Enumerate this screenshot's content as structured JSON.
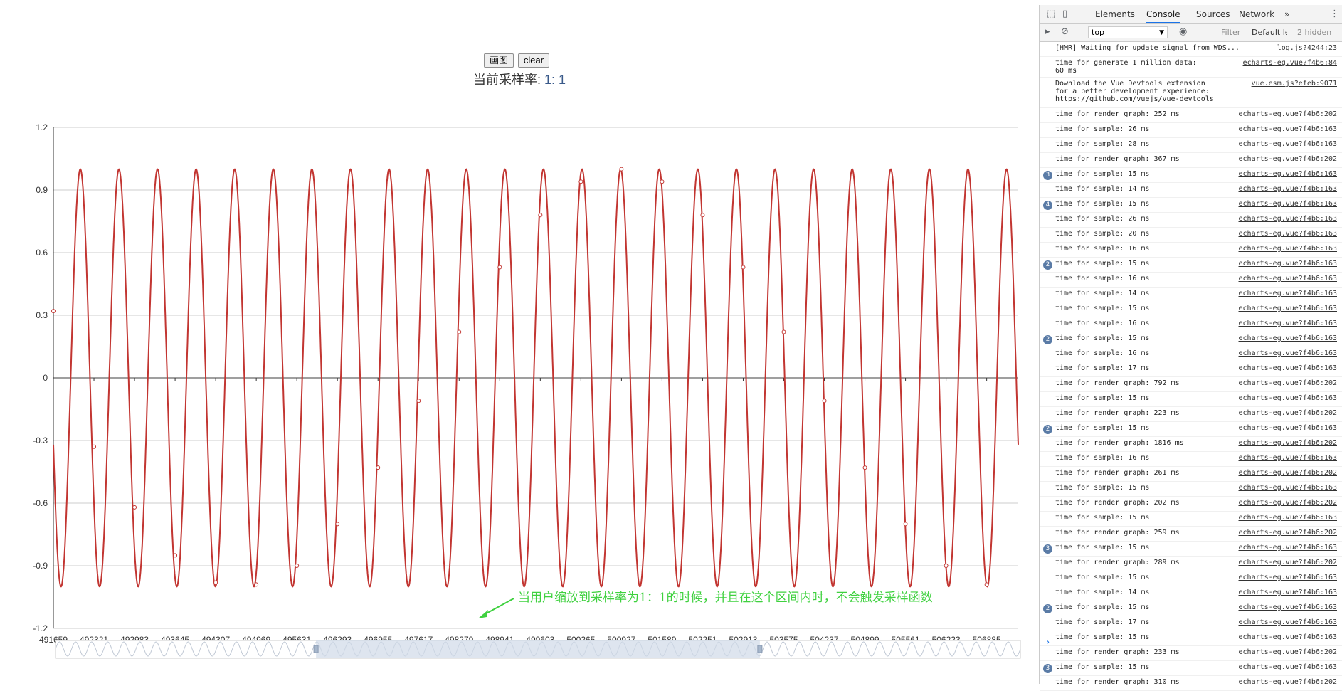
{
  "buttons": {
    "draw": "画图",
    "clear": "clear"
  },
  "rate": {
    "label": "当前采样率: ",
    "value": "1: 1"
  },
  "annotation": "当用户缩放到采样率为1：1的时候，并且在这个区间内时，不会触发采样函数",
  "colors": {
    "series": "#c23531",
    "annotation": "#3fd13f",
    "zoom_fill": "#d0dae8"
  },
  "chart_data": {
    "type": "line",
    "title": "",
    "xlabel": "",
    "ylabel": "",
    "ylim": [
      -1.2,
      1.2
    ],
    "yticks": [
      "1.2",
      "0.9",
      "0.6",
      "0.3",
      "0",
      "-0.3",
      "-0.6",
      "-0.9",
      "-1.2"
    ],
    "xlim": [
      491659,
      507400
    ],
    "xticks": [
      "491659",
      "492321",
      "492983",
      "493645",
      "494307",
      "494969",
      "495631",
      "496293",
      "496955",
      "497617",
      "498279",
      "498941",
      "499603",
      "500265",
      "500927",
      "501589",
      "502251",
      "502913",
      "503575",
      "504237",
      "504899",
      "505561",
      "506223",
      "506885"
    ],
    "grid": true,
    "series": [
      {
        "function": "sin",
        "amplitude": 1,
        "phase_at_start": 0.32,
        "cycles_in_view": 25,
        "values_at_ticks": [
          0.32,
          -0.33,
          -0.62,
          -0.85,
          -0.98,
          -0.99,
          -0.9,
          -0.7,
          -0.43,
          -0.11,
          0.22,
          0.53,
          0.78,
          0.94,
          1.0,
          0.94,
          0.78,
          0.53,
          0.22,
          -0.11,
          -0.43,
          -0.7,
          -0.9,
          -0.99
        ]
      }
    ],
    "datazoom": {
      "start_fraction": 0.27,
      "end_fraction": 0.73
    }
  },
  "devtools": {
    "tabs": [
      "Elements",
      "Console",
      "Sources",
      "Network",
      "»"
    ],
    "active_tab": "Console",
    "context": "top",
    "filter": "Filter",
    "levels": "Default levels",
    "hidden": "2 hidden",
    "messages": [
      {
        "text": "[HMR] Waiting for update signal from WDS...",
        "src": "log.js?4244:23",
        "count": ""
      },
      {
        "text": "time for generate 1 million data:\n60 ms",
        "src": "echarts-eg.vue?f4b6:84",
        "count": "",
        "tall": "2"
      },
      {
        "text": "Download the Vue Devtools extension\nfor a better development experience:\nhttps://github.com/vuejs/vue-devtools",
        "src": "vue.esm.js?efeb:9071",
        "count": "",
        "tall": "3"
      },
      {
        "text": "time for render graph: 252 ms",
        "src": "echarts-eg.vue?f4b6:202",
        "count": ""
      },
      {
        "text": "time for sample: 26 ms",
        "src": "echarts-eg.vue?f4b6:163",
        "count": ""
      },
      {
        "text": "time for sample: 28 ms",
        "src": "echarts-eg.vue?f4b6:163",
        "count": ""
      },
      {
        "text": "time for render graph: 367 ms",
        "src": "echarts-eg.vue?f4b6:202",
        "count": ""
      },
      {
        "text": "time for sample: 15 ms",
        "src": "echarts-eg.vue?f4b6:163",
        "count": "3"
      },
      {
        "text": "time for sample: 14 ms",
        "src": "echarts-eg.vue?f4b6:163",
        "count": ""
      },
      {
        "text": "time for sample: 15 ms",
        "src": "echarts-eg.vue?f4b6:163",
        "count": "4"
      },
      {
        "text": "time for sample: 26 ms",
        "src": "echarts-eg.vue?f4b6:163",
        "count": ""
      },
      {
        "text": "time for sample: 20 ms",
        "src": "echarts-eg.vue?f4b6:163",
        "count": ""
      },
      {
        "text": "time for sample: 16 ms",
        "src": "echarts-eg.vue?f4b6:163",
        "count": ""
      },
      {
        "text": "time for sample: 15 ms",
        "src": "echarts-eg.vue?f4b6:163",
        "count": "2"
      },
      {
        "text": "time for sample: 16 ms",
        "src": "echarts-eg.vue?f4b6:163",
        "count": ""
      },
      {
        "text": "time for sample: 14 ms",
        "src": "echarts-eg.vue?f4b6:163",
        "count": ""
      },
      {
        "text": "time for sample: 15 ms",
        "src": "echarts-eg.vue?f4b6:163",
        "count": ""
      },
      {
        "text": "time for sample: 16 ms",
        "src": "echarts-eg.vue?f4b6:163",
        "count": ""
      },
      {
        "text": "time for sample: 15 ms",
        "src": "echarts-eg.vue?f4b6:163",
        "count": "2"
      },
      {
        "text": "time for sample: 16 ms",
        "src": "echarts-eg.vue?f4b6:163",
        "count": ""
      },
      {
        "text": "time for sample: 17 ms",
        "src": "echarts-eg.vue?f4b6:163",
        "count": ""
      },
      {
        "text": "time for render graph: 792 ms",
        "src": "echarts-eg.vue?f4b6:202",
        "count": ""
      },
      {
        "text": "time for sample: 15 ms",
        "src": "echarts-eg.vue?f4b6:163",
        "count": ""
      },
      {
        "text": "time for render graph: 223 ms",
        "src": "echarts-eg.vue?f4b6:202",
        "count": ""
      },
      {
        "text": "time for sample: 15 ms",
        "src": "echarts-eg.vue?f4b6:163",
        "count": "2"
      },
      {
        "text": "time for render graph: 1816 ms",
        "src": "echarts-eg.vue?f4b6:202",
        "count": ""
      },
      {
        "text": "time for sample: 16 ms",
        "src": "echarts-eg.vue?f4b6:163",
        "count": ""
      },
      {
        "text": "time for render graph: 261 ms",
        "src": "echarts-eg.vue?f4b6:202",
        "count": ""
      },
      {
        "text": "time for sample: 15 ms",
        "src": "echarts-eg.vue?f4b6:163",
        "count": ""
      },
      {
        "text": "time for render graph: 202 ms",
        "src": "echarts-eg.vue?f4b6:202",
        "count": ""
      },
      {
        "text": "time for sample: 15 ms",
        "src": "echarts-eg.vue?f4b6:163",
        "count": ""
      },
      {
        "text": "time for render graph: 259 ms",
        "src": "echarts-eg.vue?f4b6:202",
        "count": ""
      },
      {
        "text": "time for sample: 15 ms",
        "src": "echarts-eg.vue?f4b6:163",
        "count": "3"
      },
      {
        "text": "time for render graph: 289 ms",
        "src": "echarts-eg.vue?f4b6:202",
        "count": ""
      },
      {
        "text": "time for sample: 15 ms",
        "src": "echarts-eg.vue?f4b6:163",
        "count": ""
      },
      {
        "text": "time for sample: 14 ms",
        "src": "echarts-eg.vue?f4b6:163",
        "count": ""
      },
      {
        "text": "time for sample: 15 ms",
        "src": "echarts-eg.vue?f4b6:163",
        "count": "2"
      },
      {
        "text": "time for sample: 17 ms",
        "src": "echarts-eg.vue?f4b6:163",
        "count": ""
      },
      {
        "text": "time for sample: 15 ms",
        "src": "echarts-eg.vue?f4b6:163",
        "count": ""
      },
      {
        "text": "time for render graph: 233 ms",
        "src": "echarts-eg.vue?f4b6:202",
        "count": ""
      },
      {
        "text": "time for sample: 15 ms",
        "src": "echarts-eg.vue?f4b6:163",
        "count": "3"
      },
      {
        "text": "time for render graph: 310 ms",
        "src": "echarts-eg.vue?f4b6:202",
        "count": ""
      }
    ],
    "prompt": "›"
  }
}
